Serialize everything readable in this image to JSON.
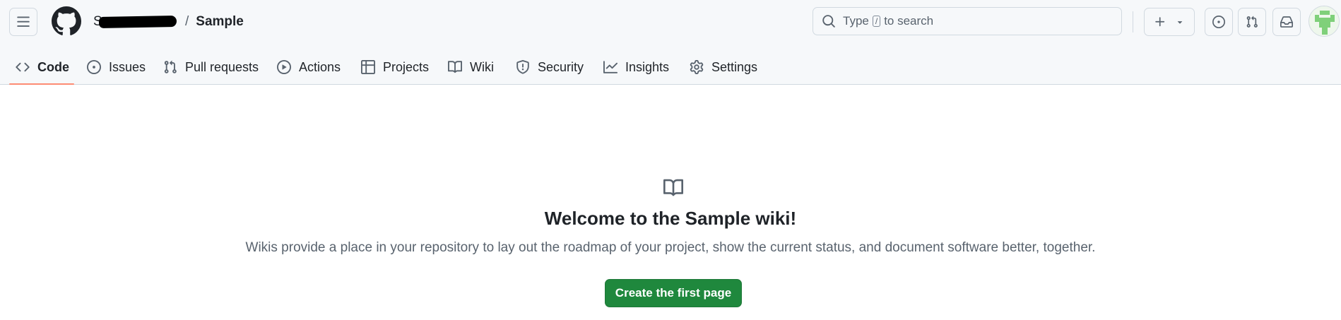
{
  "header": {
    "owner": "S",
    "separator": "/",
    "repo": "Sample"
  },
  "search": {
    "prefix": "Type",
    "key": "/",
    "suffix": "to search"
  },
  "tabs": [
    {
      "label": "Code",
      "icon": "code-icon",
      "active": true
    },
    {
      "label": "Issues",
      "icon": "issue-opened-icon"
    },
    {
      "label": "Pull requests",
      "icon": "git-pull-request-icon"
    },
    {
      "label": "Actions",
      "icon": "play-icon"
    },
    {
      "label": "Projects",
      "icon": "table-icon"
    },
    {
      "label": "Wiki",
      "icon": "book-icon"
    },
    {
      "label": "Security",
      "icon": "shield-icon"
    },
    {
      "label": "Insights",
      "icon": "graph-icon"
    },
    {
      "label": "Settings",
      "icon": "gear-icon"
    }
  ],
  "blankslate": {
    "icon": "book-icon",
    "title": "Welcome to the Sample wiki!",
    "description": "Wikis provide a place in your repository to lay out the roadmap of your project, show the current status, and document software better, together.",
    "button_label": "Create the first page"
  },
  "colors": {
    "header_bg": "#f6f8fa",
    "active_underline": "#fd8c73",
    "primary_button": "#1f883d",
    "muted_text": "#59636e"
  }
}
